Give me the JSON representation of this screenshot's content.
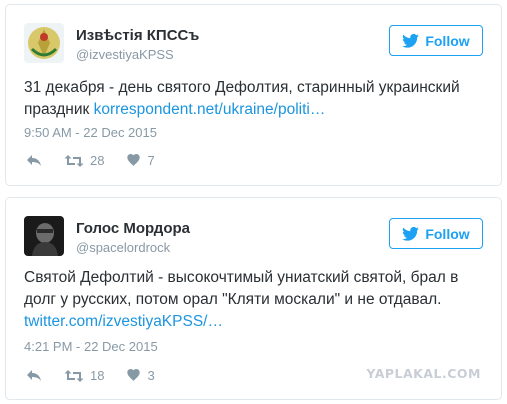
{
  "tweets": [
    {
      "display_name": "Извѣстія КПССъ",
      "handle": "@izvestiyaKPSS",
      "follow_label": "Follow",
      "text": "31 декабря - день святого Дефолтия, старинный украинский праздник ",
      "link": "korrespondent.net/ukraine/politi…",
      "timestamp": "9:50 AM - 22 Dec 2015",
      "retweets": "28",
      "likes": "7"
    },
    {
      "display_name": "Голос Мордора",
      "handle": "@spacelordrock",
      "follow_label": "Follow",
      "text": "Святой Дефолтий - высокочтимый униатский святой, брал в долг у русских, потом орал \"Кляти москали\" и не отдавал. ",
      "link": "twitter.com/izvestiyaKPSS/…",
      "timestamp": "4:21 PM - 22 Dec 2015",
      "retweets": "18",
      "likes": "3"
    }
  ],
  "watermark": "YAPLAKAL.COM",
  "colors": {
    "accent": "#1da1f2",
    "link": "#1b95e0",
    "muted": "#8899a6",
    "border": "#e1e8ed"
  },
  "icons": [
    "twitter-bird-icon",
    "reply-icon",
    "retweet-icon",
    "heart-icon"
  ]
}
